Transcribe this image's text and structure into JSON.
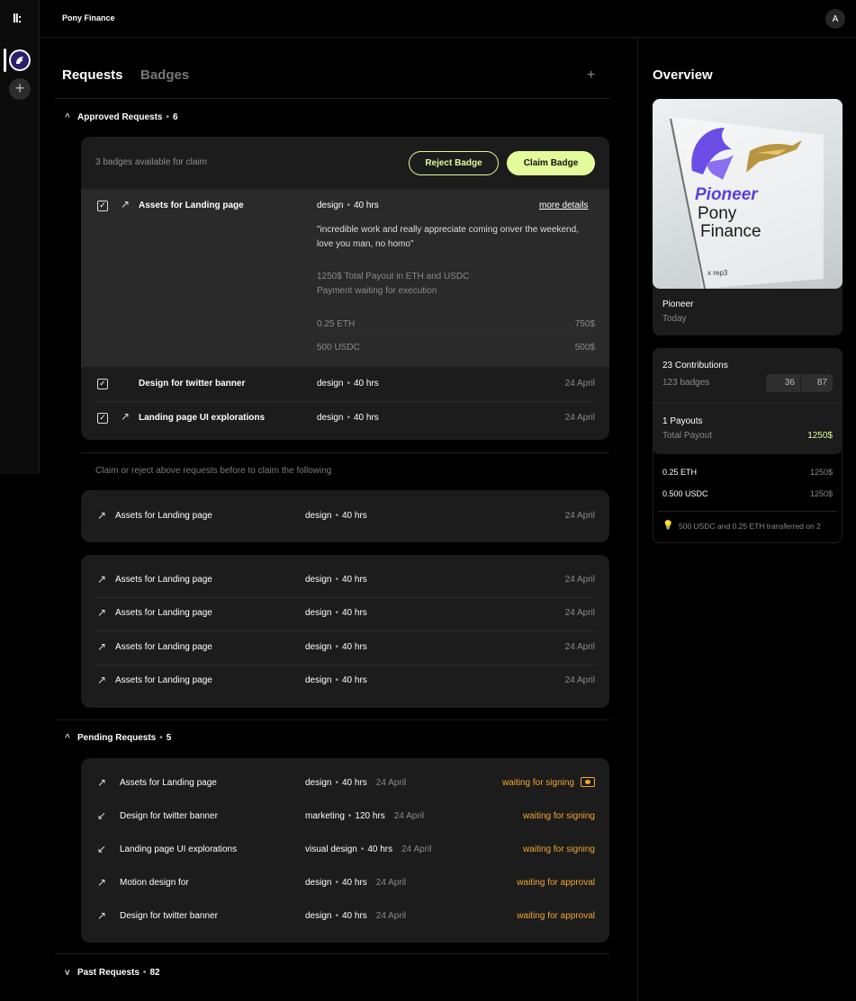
{
  "app": {
    "logo": "ll:",
    "title": "Pony Finance",
    "avatar": "A",
    "add_project": "+"
  },
  "tabs": {
    "requests": "Requests",
    "badges": "Badges",
    "add": "+"
  },
  "approved": {
    "title": "Approved Requests",
    "count": "6",
    "available": "3 badges available for claim",
    "reject_label": "Reject Badge",
    "claim_label": "Claim Badge",
    "expanded": {
      "title": "Assets for Landing page",
      "tag": "design",
      "hours": "40 hrs",
      "more": "more details",
      "quote": "\"incredible work and really appreciate coming onver the weekend, love you man, no homo\"",
      "payout_line1": "1250$ Total Payout in ETH and USDC",
      "payout_line2": "Payment waiting for execution",
      "eth_label": "0.25 ETH",
      "eth_value": "750$",
      "usdc_label": "500 USDC",
      "usdc_value": "500$"
    },
    "rows": [
      {
        "title": "Design for twitter banner",
        "tag": "design",
        "hours": "40 hrs",
        "date": "24 April"
      },
      {
        "title": "Landing page UI explorations",
        "tag": "design",
        "hours": "40 hrs",
        "date": "24 April"
      }
    ],
    "note": "Claim or reject above requests before to claim the following",
    "single": {
      "title": "Assets for Landing page",
      "tag": "design",
      "hours": "40 hrs",
      "date": "24 April"
    },
    "list": [
      {
        "title": "Assets for Landing page",
        "tag": "design",
        "hours": "40 hrs",
        "date": "24 April"
      },
      {
        "title": "Assets for Landing page",
        "tag": "design",
        "hours": "40 hrs",
        "date": "24 April"
      },
      {
        "title": "Assets for Landing page",
        "tag": "design",
        "hours": "40 hrs",
        "date": "24 April"
      },
      {
        "title": "Assets for Landing page",
        "tag": "design",
        "hours": "40 hrs",
        "date": "24 April"
      }
    ]
  },
  "pending": {
    "title": "Pending Requests",
    "count": "5",
    "rows": [
      {
        "dir": "↗",
        "title": "Assets for Landing page",
        "tag": "design",
        "hours": "40 hrs",
        "date": "24 April",
        "status": "waiting for signing"
      },
      {
        "dir": "↙",
        "title": "Design for twitter banner",
        "tag": "marketing",
        "hours": "120 hrs",
        "date": "24 April",
        "status": "waiting for signing"
      },
      {
        "dir": "↙",
        "title": "Landing page UI explorations",
        "tag": "visual design",
        "hours": "40 hrs",
        "date": "24 April",
        "status": "waiting for signing"
      },
      {
        "dir": "↗",
        "title": "Motion design for",
        "tag": "design",
        "hours": "40 hrs",
        "date": "24 April",
        "status": "waiting for approval"
      },
      {
        "dir": "↗",
        "title": "Design for twitter banner",
        "tag": "design",
        "hours": "40 hrs",
        "date": "24 April",
        "status": "waiting for approval"
      }
    ]
  },
  "past": {
    "title": "Past Requests",
    "count": "82"
  },
  "overview": {
    "title": "Overview",
    "badge_art": {
      "line1": "Pioneer",
      "line2": "Pony",
      "line3": "Finance",
      "credit": "x rep3"
    },
    "badge_name": "Pioneer",
    "badge_date": "Today",
    "contributions_title": "23 Contributions",
    "contributions_sub": "123 badges",
    "stat_a": "36",
    "stat_b": "87",
    "payouts_title": "1 Payouts",
    "payouts_sub": "Total Payout",
    "payouts_value": "1250$",
    "eth_label": "0.25 ETH",
    "eth_value": "1250$",
    "usdc_label": "0.500 USDC",
    "usdc_value": "1250$",
    "transfer_note": "500 USDC and 0.25 ETH transferred on 2"
  },
  "colors": {
    "accent": "#e3fb9a",
    "orange": "#f0a72e",
    "purple": "#6b4de6"
  }
}
